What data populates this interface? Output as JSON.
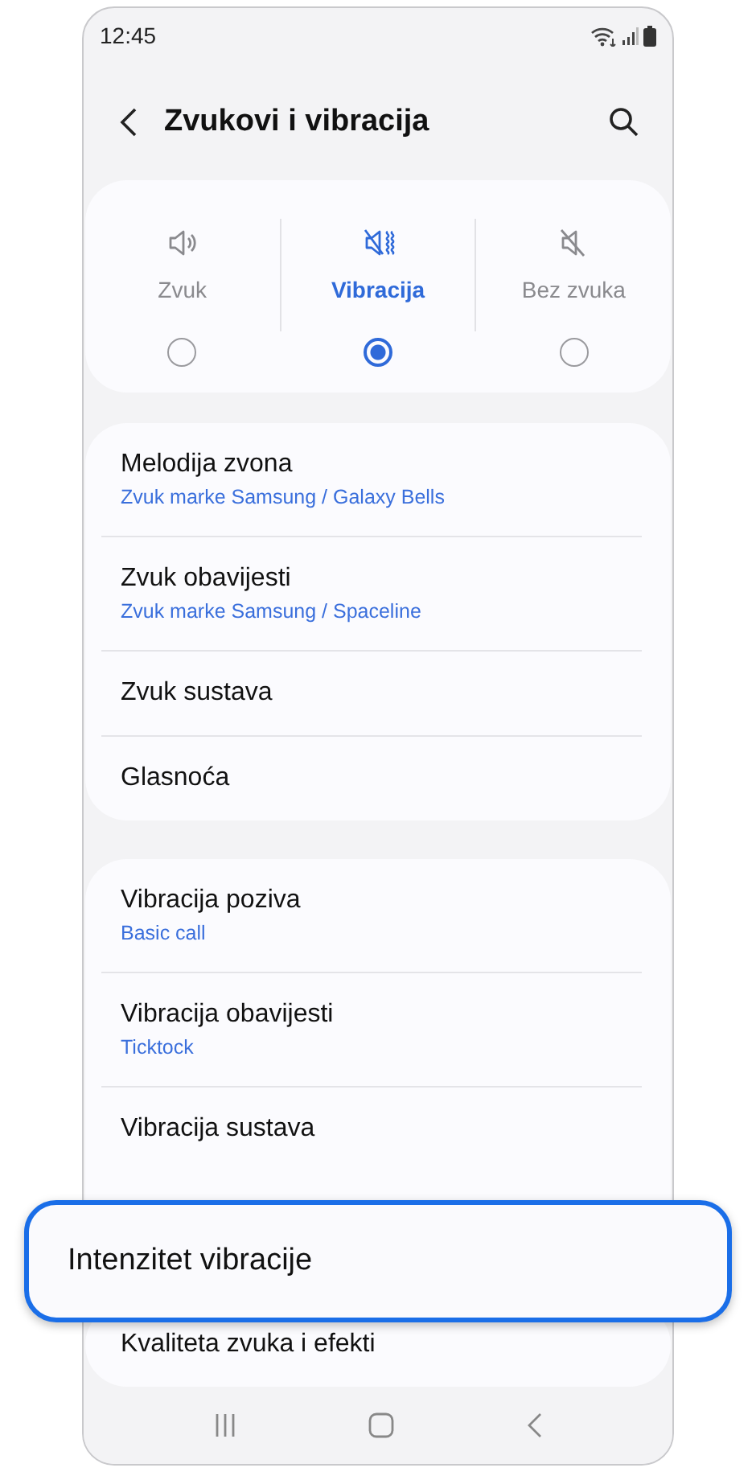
{
  "status_bar": {
    "time": "12:45"
  },
  "header": {
    "title": "Zvukovi i vibracija"
  },
  "modes": [
    {
      "kind": "sound",
      "label": "Zvuk",
      "selected": false
    },
    {
      "kind": "vibrate",
      "label": "Vibracija",
      "selected": true
    },
    {
      "kind": "mute",
      "label": "Bez zvuka",
      "selected": false
    }
  ],
  "groups": [
    {
      "items": [
        {
          "title": "Melodija zvona",
          "subtitle": "Zvuk marke Samsung / Galaxy Bells"
        },
        {
          "title": "Zvuk obavijesti",
          "subtitle": "Zvuk marke Samsung / Spaceline"
        },
        {
          "title": "Zvuk sustava"
        },
        {
          "title": "Glasnoća"
        }
      ]
    },
    {
      "items": [
        {
          "title": "Vibracija poziva",
          "subtitle": "Basic call"
        },
        {
          "title": "Vibracija obavijesti",
          "subtitle": "Ticktock"
        },
        {
          "title": "Vibracija sustava"
        }
      ]
    },
    {
      "items": [
        {
          "title": "Kvaliteta zvuka i efekti"
        }
      ]
    }
  ],
  "highlight": {
    "title": "Intenzitet vibracije"
  }
}
